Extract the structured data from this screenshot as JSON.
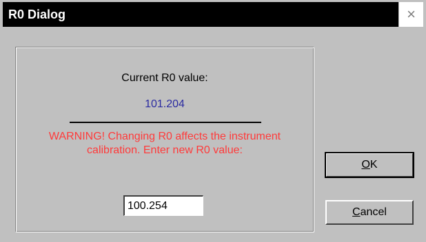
{
  "window": {
    "title": "R0 Dialog",
    "close_glyph": "×",
    "close_icon": "close-icon"
  },
  "group": {
    "current_label": "Current R0 value:",
    "current_value": "101.204",
    "warning_text": "WARNING! Changing R0 affects the instrument calibration. Enter new R0 value:",
    "input_value": "100.254"
  },
  "buttons": {
    "ok_mnemonic": "O",
    "ok_rest": "K",
    "cancel_mnemonic": "C",
    "cancel_rest": "ancel"
  },
  "colors": {
    "value": "#2a2aa0",
    "warning": "#ff3a3a",
    "titlebar": "#000000",
    "face": "#c0c0c0"
  }
}
